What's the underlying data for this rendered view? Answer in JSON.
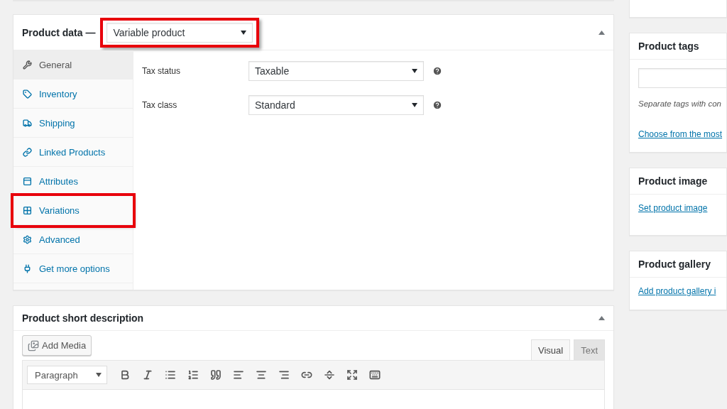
{
  "product_data": {
    "title": "Product data —",
    "product_type": {
      "value": "Variable product",
      "highlighted": true
    },
    "tabs": [
      {
        "label": "General",
        "selected": true,
        "highlighted": false
      },
      {
        "label": "Inventory",
        "selected": false,
        "highlighted": false
      },
      {
        "label": "Shipping",
        "selected": false,
        "highlighted": false
      },
      {
        "label": "Linked Products",
        "selected": false,
        "highlighted": false
      },
      {
        "label": "Attributes",
        "selected": false,
        "highlighted": false
      },
      {
        "label": "Variations",
        "selected": false,
        "highlighted": true
      },
      {
        "label": "Advanced",
        "selected": false,
        "highlighted": false
      },
      {
        "label": "Get more options",
        "selected": false,
        "highlighted": false
      }
    ],
    "fields": [
      {
        "label": "Tax status",
        "value": "Taxable"
      },
      {
        "label": "Tax class",
        "value": "Standard"
      }
    ]
  },
  "short_description": {
    "title": "Product short description",
    "add_media": "Add Media",
    "format": "Paragraph",
    "editor_tabs": [
      {
        "label": "Visual",
        "selected": true
      },
      {
        "label": "Text",
        "selected": false
      }
    ]
  },
  "sidebar": [
    {
      "kind": "tags",
      "title": "Product tags",
      "hint": "Separate tags with con",
      "link": "Choose from the most"
    },
    {
      "kind": "link",
      "title": "Product image",
      "link": "Set product image"
    },
    {
      "kind": "link",
      "title": "Product gallery",
      "link": "Add product gallery i"
    }
  ]
}
